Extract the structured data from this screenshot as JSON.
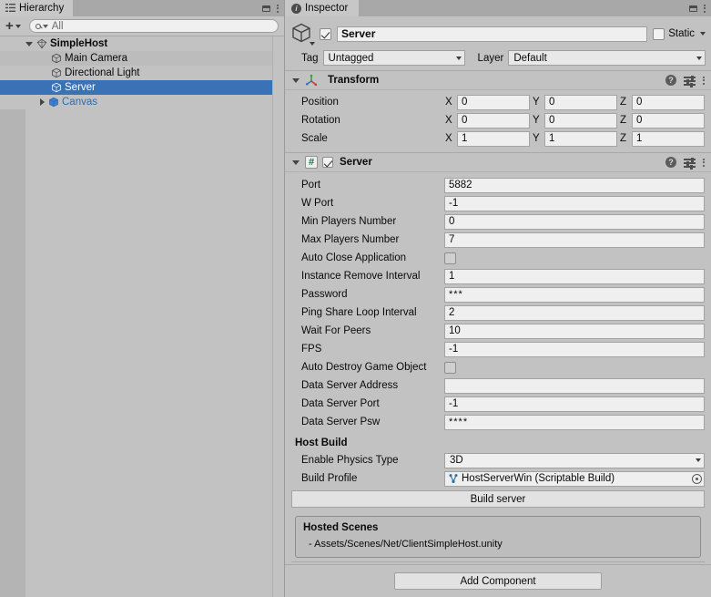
{
  "hierarchy": {
    "tab_label": "Hierarchy",
    "toolbar": {
      "add_label": "+",
      "search_placeholder": "All"
    },
    "items": [
      {
        "name": "SimpleHost",
        "icon": "scene-icon",
        "indent": 0,
        "expanded": true,
        "bold": true,
        "selected": false,
        "prefab": false,
        "has_kebab": true
      },
      {
        "name": "Main Camera",
        "icon": "cube-icon",
        "indent": 1,
        "expanded": null,
        "bold": false,
        "selected": false,
        "prefab": false,
        "has_kebab": false
      },
      {
        "name": "Directional Light",
        "icon": "cube-icon",
        "indent": 1,
        "expanded": null,
        "bold": false,
        "selected": false,
        "prefab": false,
        "has_kebab": false
      },
      {
        "name": "Server",
        "icon": "cube-icon",
        "indent": 1,
        "expanded": null,
        "bold": false,
        "selected": true,
        "prefab": false,
        "has_kebab": false
      },
      {
        "name": "Canvas",
        "icon": "prefab-icon",
        "indent": 1,
        "expanded": false,
        "bold": false,
        "selected": false,
        "prefab": true,
        "has_kebab": false
      }
    ]
  },
  "inspector": {
    "tab_label": "Inspector",
    "game_object": {
      "enabled": true,
      "name": "Server",
      "static_label": "Static",
      "static_checked": false,
      "tag_label": "Tag",
      "tag_value": "Untagged",
      "layer_label": "Layer",
      "layer_value": "Default"
    },
    "components": [
      {
        "title": "Transform",
        "icon": "transform-axis-icon",
        "expanded": true,
        "has_enable_checkbox": false,
        "vectors": [
          {
            "label": "Position",
            "x": "0",
            "y": "0",
            "z": "0"
          },
          {
            "label": "Rotation",
            "x": "0",
            "y": "0",
            "z": "0"
          },
          {
            "label": "Scale",
            "x": "1",
            "y": "1",
            "z": "1"
          }
        ]
      },
      {
        "title": "Server",
        "icon": "script-icon",
        "expanded": true,
        "has_enable_checkbox": true,
        "enabled": true,
        "properties": [
          {
            "label": "Port",
            "type": "text",
            "value": "5882"
          },
          {
            "label": "W Port",
            "type": "text",
            "value": "-1"
          },
          {
            "label": "Min Players Number",
            "type": "text",
            "value": "0"
          },
          {
            "label": "Max Players Number",
            "type": "text",
            "value": "7"
          },
          {
            "label": "Auto Close Application",
            "type": "checkbox",
            "value": false
          },
          {
            "label": "Instance Remove Interval",
            "type": "text",
            "value": "1"
          },
          {
            "label": "Password",
            "type": "password",
            "value": "***"
          },
          {
            "label": "Ping Share Loop Interval",
            "type": "text",
            "value": "2"
          },
          {
            "label": "Wait For Peers",
            "type": "text",
            "value": "10"
          },
          {
            "label": "FPS",
            "type": "text",
            "value": "-1"
          },
          {
            "label": "Auto Destroy Game Object",
            "type": "checkbox",
            "value": false
          },
          {
            "label": "Data Server Address",
            "type": "text",
            "value": ""
          },
          {
            "label": "Data Server Port",
            "type": "text",
            "value": "-1"
          },
          {
            "label": "Data Server Psw",
            "type": "password",
            "value": "****"
          }
        ],
        "host_build": {
          "section_title": "Host Build",
          "physics_label": "Enable Physics Type",
          "physics_value": "3D",
          "profile_label": "Build Profile",
          "profile_value": "HostServerWin (Scriptable Build)",
          "profile_icon": "scriptable-object-icon",
          "build_button": "Build server"
        },
        "hosted_scenes": {
          "title": "Hosted Scenes",
          "lines": [
            "- Assets/Scenes/Net/ClientSimpleHost.unity"
          ]
        }
      }
    ],
    "add_component_label": "Add Component"
  },
  "colors": {
    "selection_blue": "#3a72b8",
    "prefab_blue": "#2e6bb5",
    "panel_bg": "#c2c2c2",
    "field_bg": "#efefef",
    "script_green": "#1f7a3f"
  }
}
